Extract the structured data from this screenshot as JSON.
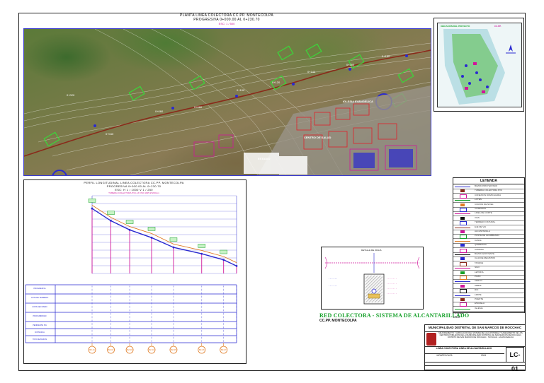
{
  "plan": {
    "title": "PLANTA LINEA COLECTORA CC.PP. MONTECOLPA",
    "progressive": "PROGRESIVA 0+000.00 AL 0+230.70",
    "scale": "ESC: 1 / 500",
    "stations": [
      "0+020",
      "0+040",
      "0+060",
      "0+080",
      "0+100",
      "0+120",
      "0+140",
      "0+160",
      "0+180",
      "0+200",
      "0+220"
    ],
    "place_labels": [
      "IGLESIA EVANGELICA",
      "CENTRO DE SALUD",
      "ESTADIO",
      "COLEGIO"
    ]
  },
  "inset": {
    "title": "UBICACIÓN DEL PROYECTO",
    "tag": "CC.PP."
  },
  "profile": {
    "title": "PERFIL LONGITUDINAL LINEA COLECTORA CC.PP. MONTECOLPA",
    "progressive": "PROGRESIVA 0+000.00 AL 0+230.70",
    "scale": "ESC: H 1 / 1000  V 1 / 250",
    "note": "TUBERIA COLECTORA PVC-UF ISO 4435 Ø 200mm",
    "row_labels": [
      "PROGRESIVA",
      "COTA DE TERRENO",
      "COTA DE FONDO",
      "PROFUNDIDAD",
      "PENDIENTE S%",
      "DISTANCIA",
      "TIPO DE BUZON"
    ],
    "manholes": [
      "BZ-01",
      "BZ-02",
      "BZ-03",
      "BZ-04",
      "BZ-05",
      "BZ-06",
      "BZ-07"
    ],
    "terrain": [
      {
        "d": 0,
        "z": 3208.6
      },
      {
        "d": 30,
        "z": 3204.2
      },
      {
        "d": 60,
        "z": 3200.9
      },
      {
        "d": 95,
        "z": 3198.4
      },
      {
        "d": 130,
        "z": 3194.6
      },
      {
        "d": 175,
        "z": 3192.3
      },
      {
        "d": 210,
        "z": 3190.1
      },
      {
        "d": 230.7,
        "z": 3187.9
      }
    ],
    "pipe": [
      {
        "d": 0,
        "z": 3207.4
      },
      {
        "d": 30,
        "z": 3203.0
      },
      {
        "d": 60,
        "z": 3199.7
      },
      {
        "d": 95,
        "z": 3196.9
      },
      {
        "d": 130,
        "z": 3193.4
      },
      {
        "d": 175,
        "z": 3191.1
      },
      {
        "d": 210,
        "z": 3188.9
      },
      {
        "d": 230.7,
        "z": 3186.7
      }
    ],
    "xlim": [
      0,
      230.7
    ],
    "ylim": [
      3184,
      3212
    ]
  },
  "legend": {
    "title": "LEYENDA",
    "items": [
      "BUZON PROYECTADO",
      "TUBERIA COLECTORA PVC",
      "CONEXION DOMICILIARIA",
      "LOTES",
      "CURVAS DE NIVEL",
      "VIVIENDAS",
      "LINEA DE CORTE",
      "VIAS",
      "TERRENO NATURAL",
      "EJE DE VIA",
      "ALCANTARILLA",
      "POSTE DE ALUMBRADO",
      "CANAL",
      "QUEBRADA",
      "CAMARA",
      "BUZON EXISTENTE",
      "CAJA DE REGISTRO",
      "TANQUE",
      "SILO",
      "LETRINA",
      "POZO",
      "CERCO",
      "ARBOL",
      "RIO",
      "LIMITE",
      "PUENTE",
      "ESCUELA",
      "IGLESIA"
    ]
  },
  "section": {
    "label": "DETALLE DE ZANJA"
  },
  "caption": {
    "main": "RED COLECTORA - SISTEMA DE ALCANTARILLADO",
    "sub": "CC.PP. MONTECOLPA",
    "scale_label": "ESCALA",
    "scale_value": "1/500"
  },
  "titleblock": {
    "entity": "MUNICIPALIDAD DISTRITAL DE SAN MARCOS DE ROCCHAC",
    "project": "MEJORAMIENTO Y AMPLIACION DEL SISTEMA DE AGUA POTABLE Y SANEAMIENTO DE LOS CENTROS POBLADOS DE LA MUNICIPALIDAD DISTRITAL DE SAN MARCOS DE ROCCHAC, DISTRITO DE SAN MARCOS DE ROCCHAC - TAYACAJA - HUANCAVELICA",
    "plan": "LINEA COLECTORA LINEA DE ALCANTARILLADO",
    "code": "LC-01",
    "place": "MONTECOLPA",
    "date": "2024"
  },
  "colors": {
    "blue": "#2a2ad0",
    "magenta": "#d0169a",
    "green": "#16a12a",
    "orange": "#e07a22",
    "dark_red": "#8a2a1a"
  }
}
